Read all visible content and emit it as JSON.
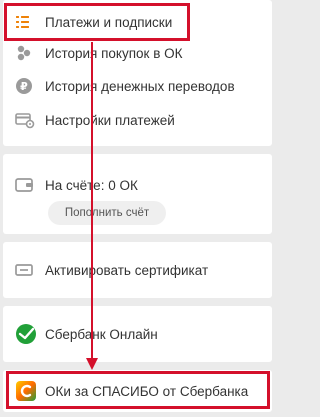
{
  "menu": {
    "items": [
      {
        "label": "Платежи и подписки",
        "icon": "list-icon"
      },
      {
        "label": "История покупок в ОК",
        "icon": "coins-icon"
      },
      {
        "label": "История денежных переводов",
        "icon": "ruble-icon"
      },
      {
        "label": "Настройки платежей",
        "icon": "card-settings-icon"
      }
    ]
  },
  "balance": {
    "label": "На счёте: 0 ОК",
    "topup_label": "Пополнить счёт",
    "icon": "wallet-icon"
  },
  "certificate": {
    "label": "Активировать сертификат",
    "icon": "ticket-icon"
  },
  "sberbank": {
    "label": "Сбербанк Онлайн",
    "icon": "sberbank-logo-icon"
  },
  "spasibo": {
    "label": "ОКи за СПАСИБО от Сбербанка",
    "icon": "spasibo-logo-icon"
  },
  "colors": {
    "accent": "#ee8208",
    "highlight": "#d4102b",
    "sber_green": "#21a038"
  }
}
